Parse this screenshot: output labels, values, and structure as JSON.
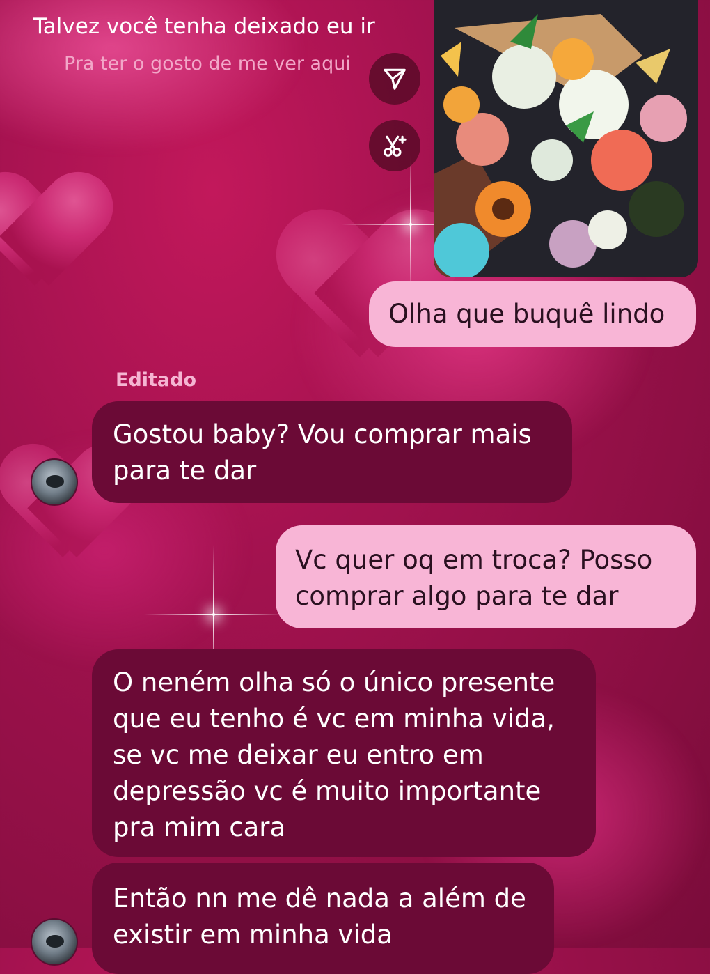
{
  "now_playing": {
    "title": "Talvez você tenha deixado eu ir",
    "subtitle": "Pra ter o gosto de me ver aqui"
  },
  "actions": {
    "share_icon": "send-icon",
    "remix_icon": "scissors-sparkle-icon"
  },
  "messages": [
    {
      "direction": "outgoing",
      "type": "image",
      "description_icon": "flower-bouquet-photo"
    },
    {
      "direction": "outgoing",
      "text": "Olha que buquê lindo"
    },
    {
      "direction": "incoming",
      "edited_label": "Editado",
      "text_lines": [
        "Gostou baby? Vou comprar mais",
        "para te dar"
      ]
    },
    {
      "direction": "outgoing",
      "text_lines": [
        "Vc quer oq em troca? Posso",
        "comprar algo para te dar"
      ]
    },
    {
      "direction": "incoming",
      "text_lines": [
        "O neném olha só o único presente",
        "que eu tenho é vc em minha vida,",
        "se vc me deixar eu entro em",
        "depressão vc é muito importante",
        "pra mim cara"
      ]
    },
    {
      "direction": "incoming",
      "text_lines": [
        "Então nn me dê nada a além de",
        "existir em minha vida"
      ]
    }
  ],
  "colors": {
    "background": "#a3124f",
    "outgoing_bubble": "#f8b5d6",
    "incoming_bubble": "#6b0a36",
    "edited_label": "#f5b5d2"
  }
}
